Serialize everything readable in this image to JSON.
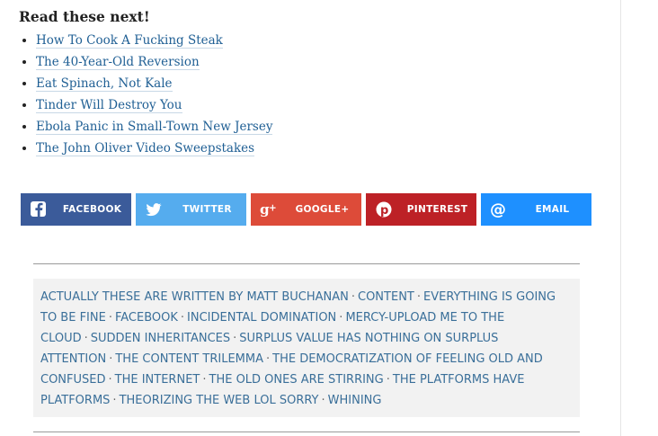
{
  "read_next": {
    "heading": "Read these next!",
    "links": [
      "How To Cook A Fucking Steak",
      "The 40-Year-Old Reversion",
      "Eat Spinach, Not Kale",
      "Tinder Will Destroy You",
      "Ebola Panic in Small-Town New Jersey",
      "The John Oliver Video Sweepstakes"
    ]
  },
  "share": {
    "facebook": {
      "label": "FACEBOOK",
      "icon": "facebook-icon",
      "color": "#3b5b9a"
    },
    "twitter": {
      "label": "TWITTER",
      "icon": "twitter-icon",
      "color": "#55acee"
    },
    "googleplus": {
      "label": "GOOGLE+",
      "icon": "googleplus-icon",
      "color": "#dd4b39"
    },
    "pinterest": {
      "label": "PINTEREST",
      "icon": "pinterest-icon",
      "color": "#bd2126"
    },
    "email": {
      "label": "EMAIL",
      "icon": "at-sign-icon",
      "color": "#1e90ff"
    }
  },
  "tags": [
    "Actually These Are Written By Matt Buchanan",
    "Content",
    "Everything Is Going To Be Fine",
    "Facebook",
    "Incidental Domination",
    "Mercy-Upload Me To The Cloud",
    "Sudden Inheritances",
    "Surplus Value Has Nothing On Surplus Attention",
    "The Content Trilemma",
    "The Democratization Of Feeling Old And Confused",
    "The Internet",
    "The Old Ones Are Stirring",
    "The Platforms Have Platforms",
    "Theorizing The Web LOL Sorry",
    "Whining"
  ],
  "tag_separator": "·"
}
